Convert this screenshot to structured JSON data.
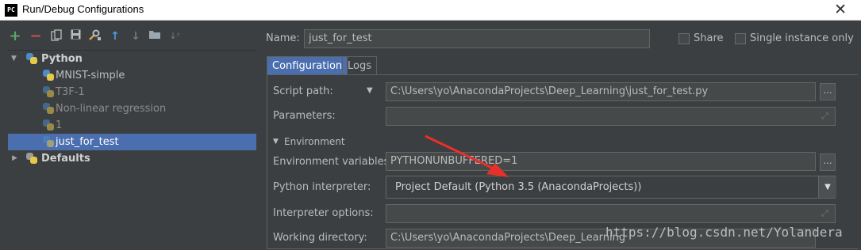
{
  "window": {
    "title": "Run/Debug Configurations",
    "app_icon_text": "PC"
  },
  "toolbar": {
    "add": "+",
    "remove": "−",
    "copy_icon": "copy-icon",
    "save_icon": "save-icon",
    "edit_defaults_icon": "wrench-icon",
    "move_up": "↑",
    "move_down": "↓",
    "folder_icon": "folder-icon",
    "sort_icon": "sort-icon"
  },
  "tree": {
    "python_group": "Python",
    "items": [
      "MNIST-simple",
      "T3F-1",
      "Non-linear regression",
      "1",
      "just_for_test"
    ],
    "defaults_group": "Defaults"
  },
  "config": {
    "name_label": "Name:",
    "name_value": "just_for_test",
    "share_label": "Share",
    "single_instance_label": "Single instance only",
    "tab_configuration": "Configuration",
    "tab_logs": "Logs",
    "script_path_label": "Script path:",
    "script_path_value": "C:\\Users\\yo\\AnacondaProjects\\Deep_Learning\\just_for_test.py",
    "parameters_label": "Parameters:",
    "parameters_value": "",
    "environment_section": "Environment",
    "env_vars_label": "Environment variables:",
    "env_vars_value": "PYTHONUNBUFFERED=1",
    "interpreter_label": "Python interpreter:",
    "interpreter_value": "Project Default (Python 3.5 (AnacondaProjects))",
    "interp_options_label": "Interpreter options:",
    "interp_options_value": "",
    "working_dir_label": "Working directory:",
    "working_dir_value": "C:\\Users\\yo\\AnacondaProjects\\Deep_Learning",
    "browse_label": "..."
  },
  "watermark": "https://blog.csdn.net/Yolandera",
  "colors": {
    "selection": "#4b6eaf",
    "panel_bg": "#3c3f41",
    "annotation_arrow": "#e8302a"
  }
}
